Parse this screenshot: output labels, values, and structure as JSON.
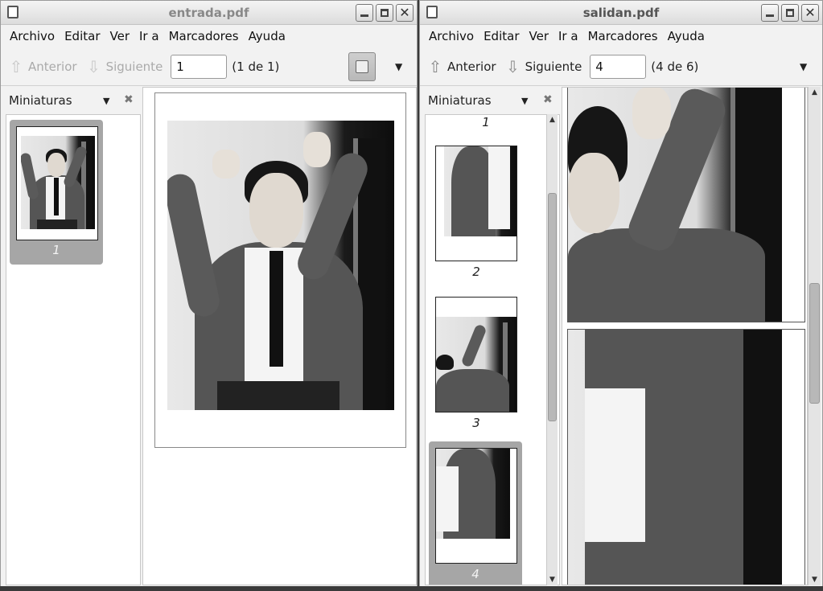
{
  "left_window": {
    "title": "entrada.pdf",
    "menu": [
      "Archivo",
      "Editar",
      "Ver",
      "Ir a",
      "Marcadores",
      "Ayuda"
    ],
    "toolbar": {
      "prev_label": "Anterior",
      "next_label": "Siguiente",
      "page_value": "1",
      "page_count": "(1 de 1)"
    },
    "sidebar": {
      "title": "Miniaturas",
      "thumbnails": [
        {
          "label": "1",
          "selected": true
        }
      ]
    }
  },
  "right_window": {
    "title": "salidan.pdf",
    "menu": [
      "Archivo",
      "Editar",
      "Ver",
      "Ir a",
      "Marcadores",
      "Ayuda"
    ],
    "toolbar": {
      "prev_label": "Anterior",
      "next_label": "Siguiente",
      "page_value": "4",
      "page_count": "(4 de 6)"
    },
    "sidebar": {
      "title": "Miniaturas",
      "thumbnails": [
        {
          "label": "1",
          "selected": false
        },
        {
          "label": "2",
          "selected": false
        },
        {
          "label": "3",
          "selected": false
        },
        {
          "label": "4",
          "selected": true
        }
      ]
    }
  },
  "icons": {
    "close": "close-icon",
    "minimize": "minimize-icon",
    "maximize": "maximize-icon",
    "prev": "up-arrow-icon",
    "next": "down-arrow-icon",
    "dropdown": "chevron-down-icon"
  }
}
